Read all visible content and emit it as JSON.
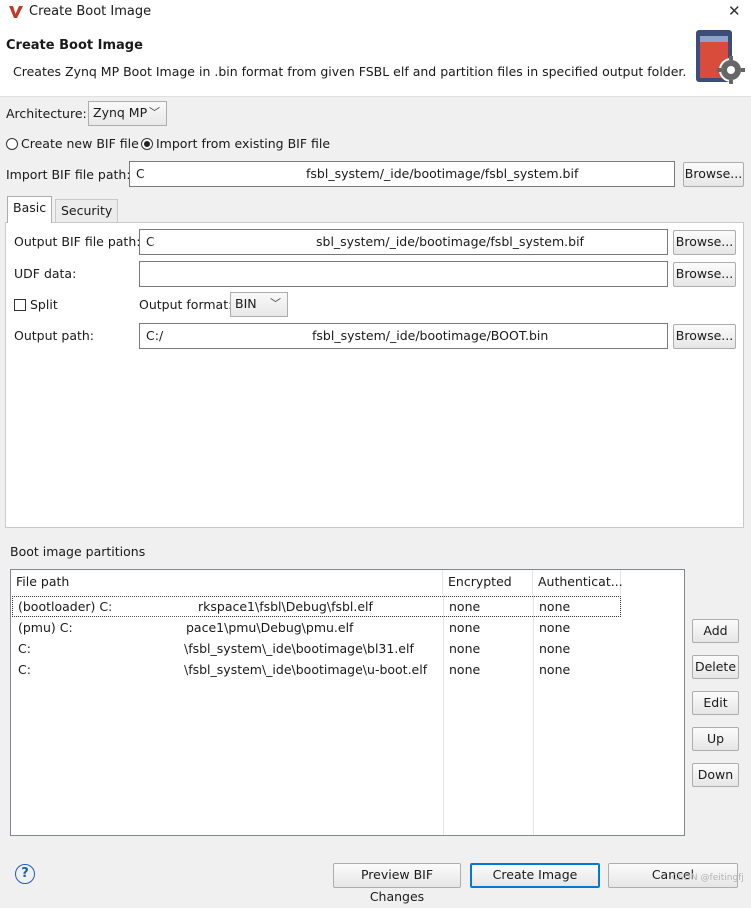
{
  "window": {
    "title": "Create Boot Image",
    "close_glyph": "✕"
  },
  "header": {
    "title": "Create Boot Image",
    "description": "Creates Zynq MP Boot Image in .bin format from given FSBL elf and partition files in specified output folder."
  },
  "architecture": {
    "label": "Architecture:",
    "value": "Zynq MP"
  },
  "bif_mode": {
    "create_label": "Create new BIF file",
    "import_label": "Import from existing BIF file",
    "selected": "import"
  },
  "import_bif": {
    "label": "Import BIF file path:",
    "prefix": "C",
    "value": "fsbl_system/_ide/bootimage/fsbl_system.bif",
    "browse": "Browse..."
  },
  "tabs": [
    {
      "label": "Basic",
      "active": true
    },
    {
      "label": "Security",
      "active": false
    }
  ],
  "basic": {
    "output_bif": {
      "label": "Output BIF file path:",
      "prefix": "C",
      "value": "sbl_system/_ide/bootimage/fsbl_system.bif",
      "browse": "Browse..."
    },
    "udf": {
      "label": "UDF data:",
      "value": "",
      "browse": "Browse..."
    },
    "split": {
      "label": "Split",
      "checked": false
    },
    "output_format": {
      "label": "Output format:",
      "value": "BIN"
    },
    "output_path": {
      "label": "Output path:",
      "prefix": "C:/",
      "value": "fsbl_system/_ide/bootimage/BOOT.bin",
      "browse": "Browse..."
    }
  },
  "partitions": {
    "title": "Boot image partitions",
    "columns": [
      "File path",
      "Encrypted",
      "Authenticat..."
    ],
    "rows": [
      {
        "path_prefix": "(bootloader) C:",
        "path_suffix": "rkspace1\\fsbl\\Debug\\fsbl.elf",
        "encrypted": "none",
        "authentication": "none",
        "selected": true
      },
      {
        "path_prefix": "(pmu) C:",
        "path_suffix": "pace1\\pmu\\Debug\\pmu.elf",
        "encrypted": "none",
        "authentication": "none",
        "selected": false
      },
      {
        "path_prefix": "C:",
        "path_suffix": "\\fsbl_system\\_ide\\bootimage\\bl31.elf",
        "encrypted": "none",
        "authentication": "none",
        "selected": false
      },
      {
        "path_prefix": "C:",
        "path_suffix": "\\fsbl_system\\_ide\\bootimage\\u-boot.elf",
        "encrypted": "none",
        "authentication": "none",
        "selected": false
      }
    ],
    "buttons": {
      "add": "Add",
      "delete": "Delete",
      "edit": "Edit",
      "up": "Up",
      "down": "Down"
    }
  },
  "footer": {
    "help": "?",
    "preview": "Preview BIF Changes",
    "create": "Create Image",
    "cancel": "Cancel",
    "watermark": "CSDN @feitingfj"
  },
  "colors": {
    "accent": "#c0392b",
    "focus_border": "#0078d7",
    "selection_border": "#333333"
  }
}
